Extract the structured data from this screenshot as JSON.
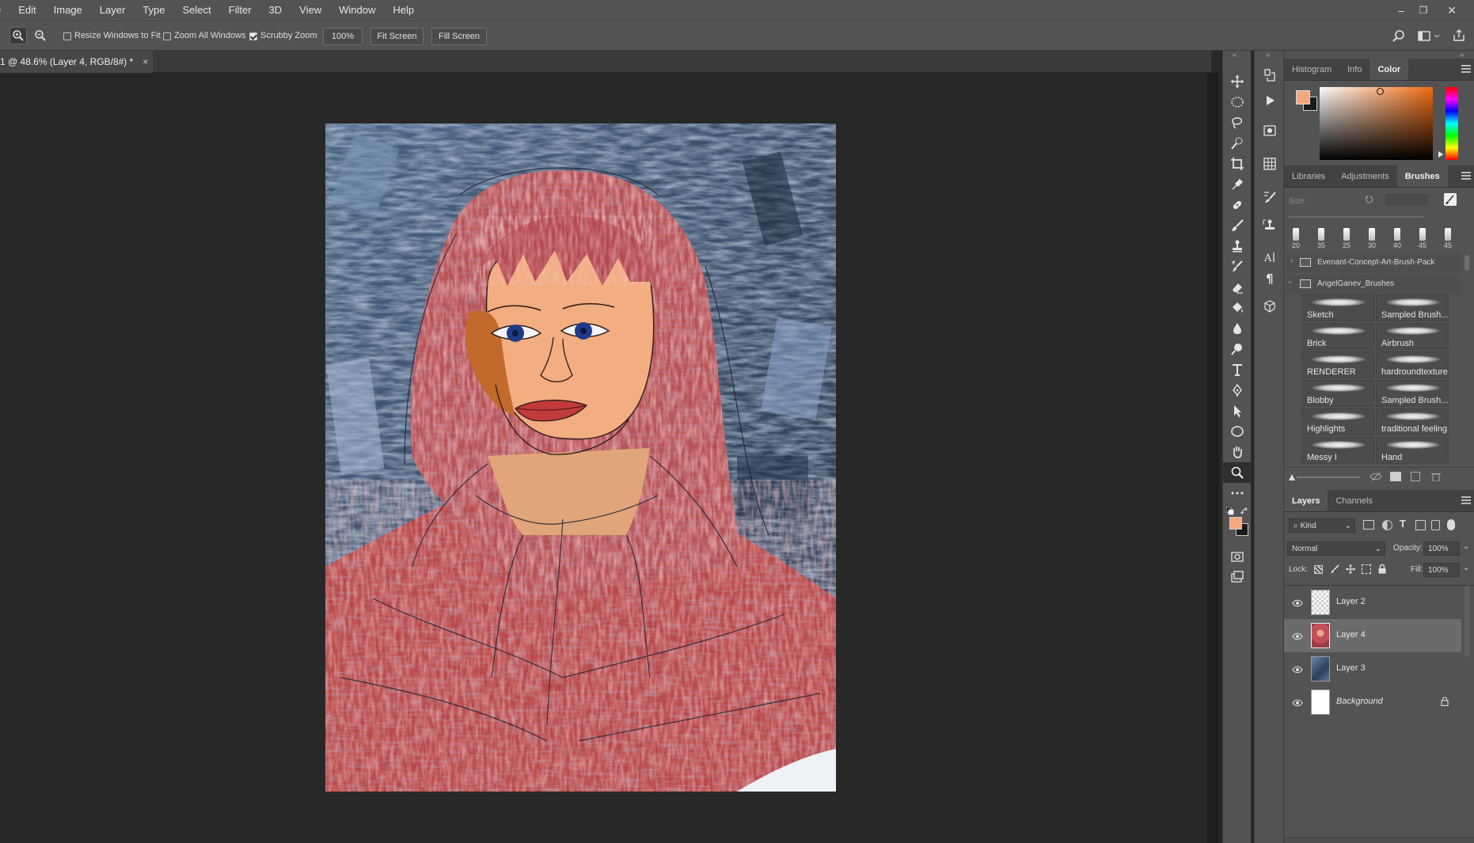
{
  "menu": {
    "items": [
      "e",
      "Edit",
      "Image",
      "Layer",
      "Type",
      "Select",
      "Filter",
      "3D",
      "View",
      "Window",
      "Help"
    ]
  },
  "window_controls": {
    "minimize": "–",
    "restore": "❐",
    "close": "✕"
  },
  "options_bar": {
    "resize_windows_label": "Resize Windows to Fit",
    "resize_windows_checked": false,
    "zoom_all_label": "Zoom All Windows",
    "zoom_all_checked": false,
    "scrubby_zoom_label": "Scrubby Zoom",
    "scrubby_zoom_checked": true,
    "zoom_value": "100%",
    "fit_screen_label": "Fit Screen",
    "fill_screen_label": "Fill Screen"
  },
  "document": {
    "tab_title": "1 @ 48.6% (Layer 4, RGB/8#) *",
    "close_glyph": "×"
  },
  "colors": {
    "foreground": "#f3a77c",
    "background": "#1a1a1a",
    "accent_panel": "#535353"
  },
  "color_panel": {
    "tabs": [
      "Histogram",
      "Info",
      "Color"
    ],
    "active_tab": "Color"
  },
  "brushes_panel": {
    "tabs": [
      "Libraries",
      "Adjustments",
      "Brushes"
    ],
    "active_tab": "Brushes",
    "size_label": "Size:",
    "presets": [
      "20",
      "35",
      "25",
      "30",
      "40",
      "45",
      "45"
    ],
    "groups": [
      "Evenant-Concept-Art-Brush-Pack",
      "AngelGanev_Brushes"
    ],
    "brushes": [
      [
        "Sketch",
        "Sampled Brush..."
      ],
      [
        "Brick",
        "Airbrush"
      ],
      [
        "RENDERER",
        "hardroundtexture"
      ],
      [
        "Blobby",
        "Sampled Brush..."
      ],
      [
        "Highlights",
        "traditional feeling"
      ],
      [
        "Messy I",
        "Hand"
      ]
    ]
  },
  "layers_panel": {
    "tabs": [
      "Layers",
      "Channels"
    ],
    "active_tab": "Layers",
    "filter_label": "Kind",
    "blend_mode": "Normal",
    "opacity_label": "Opacity:",
    "opacity_value": "100%",
    "lock_label": "Lock:",
    "fill_label": "Fill:",
    "fill_value": "100%",
    "layers": [
      {
        "name": "Layer 2",
        "selected": false
      },
      {
        "name": "Layer 4",
        "selected": true
      },
      {
        "name": "Layer 3",
        "selected": false
      },
      {
        "name": "Background",
        "selected": false,
        "locked": true
      }
    ]
  },
  "tools": [
    "move-tool",
    "marquee-tool",
    "lasso-tool",
    "quick-select-tool",
    "crop-tool",
    "eyedropper-tool",
    "healing-tool",
    "brush-tool",
    "stamp-tool",
    "history-brush-tool",
    "eraser-tool",
    "bucket-tool",
    "blur-tool",
    "dodge-tool",
    "type-tool",
    "pen-tool",
    "path-select-tool",
    "ellipse-tool",
    "hand-tool",
    "zoom-tool",
    "more-tools"
  ]
}
